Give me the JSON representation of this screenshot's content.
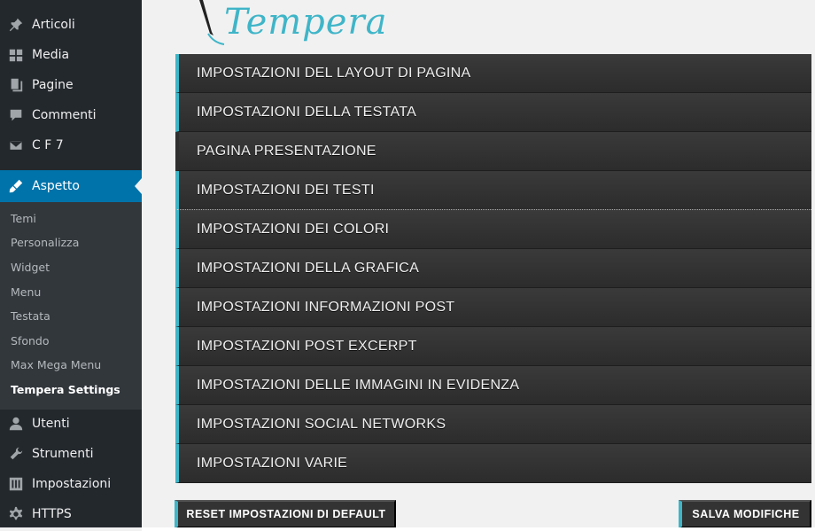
{
  "sidebar": {
    "top_items": [
      {
        "label": "Articoli",
        "icon": "pin-icon"
      },
      {
        "label": "Media",
        "icon": "media-icon"
      },
      {
        "label": "Pagine",
        "icon": "pages-icon"
      },
      {
        "label": "Commenti",
        "icon": "comment-icon"
      },
      {
        "label": "C F 7",
        "icon": "mail-icon"
      }
    ],
    "active_item": {
      "label": "Aspetto",
      "icon": "brush-icon"
    },
    "submenu": [
      "Temi",
      "Personalizza",
      "Widget",
      "Menu",
      "Testata",
      "Sfondo",
      "Max Mega Menu",
      "Tempera Settings"
    ],
    "current_submenu": "Tempera Settings",
    "bottom_items": [
      {
        "label": "Utenti",
        "icon": "user-icon"
      },
      {
        "label": "Strumenti",
        "icon": "wrench-icon"
      },
      {
        "label": "Impostazioni",
        "icon": "settings-icon"
      },
      {
        "label": "HTTPS",
        "icon": "gear-icon"
      }
    ]
  },
  "logo": {
    "text": "Tempera"
  },
  "panels": [
    "IMPOSTAZIONI DEL LAYOUT DI PAGINA",
    "IMPOSTAZIONI DELLA TESTATA",
    "PAGINA PRESENTAZIONE",
    "IMPOSTAZIONI DEI TESTI",
    "IMPOSTAZIONI DEI COLORI",
    "IMPOSTAZIONI DELLA GRAFICA",
    "IMPOSTAZIONI INFORMAZIONI POST",
    "IMPOSTAZIONI POST EXCERPT",
    "IMPOSTAZIONI DELLE IMMAGINI IN EVIDENZA",
    "IMPOSTAZIONI SOCIAL NETWORKS",
    "IMPOSTAZIONI VARIE"
  ],
  "buttons": {
    "reset": "RESET IMPOSTAZIONI DI DEFAULT",
    "save": "SALVA MODIFICHE"
  },
  "colors": {
    "sidebar_bg": "#23282d",
    "submenu_bg": "#32373c",
    "active_blue": "#0073aa",
    "accent_teal": "#3fb5c8",
    "panel_bg": "#333333"
  }
}
